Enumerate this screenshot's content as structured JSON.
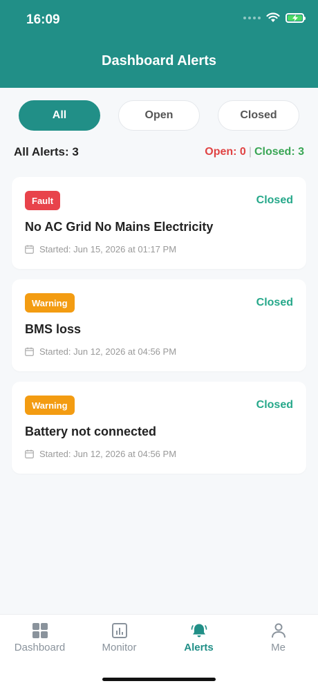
{
  "status_bar": {
    "time": "16:09"
  },
  "header": {
    "title": "Dashboard Alerts"
  },
  "filters": [
    {
      "label": "All",
      "active": true
    },
    {
      "label": "Open",
      "active": false
    },
    {
      "label": "Closed",
      "active": false
    }
  ],
  "summary": {
    "all_label": "All Alerts: 3",
    "open_label": "Open: 0",
    "separator": "|",
    "closed_label": "Closed: 3"
  },
  "alerts": [
    {
      "badge": "Fault",
      "status": "Closed",
      "title": "No AC Grid No Mains Electricity",
      "started": "Started: Jun 15, 2026 at 01:17 PM"
    },
    {
      "badge": "Warning",
      "status": "Closed",
      "title": "BMS loss",
      "started": "Started: Jun 12, 2026 at 04:56 PM"
    },
    {
      "badge": "Warning",
      "status": "Closed",
      "title": "Battery not connected",
      "started": "Started: Jun 12, 2026 at 04:56 PM"
    }
  ],
  "tabbar": [
    {
      "label": "Dashboard",
      "icon": "dashboard-icon"
    },
    {
      "label": "Monitor",
      "icon": "monitor-icon"
    },
    {
      "label": "Alerts",
      "icon": "bell-icon",
      "active": true
    },
    {
      "label": "Me",
      "icon": "person-icon"
    }
  ],
  "colors": {
    "primary": "#218f87",
    "fault": "#e8434b",
    "warning": "#f39c12",
    "closed_status": "#26a88a",
    "open_count": "#e04343",
    "closed_count": "#3aa655"
  }
}
